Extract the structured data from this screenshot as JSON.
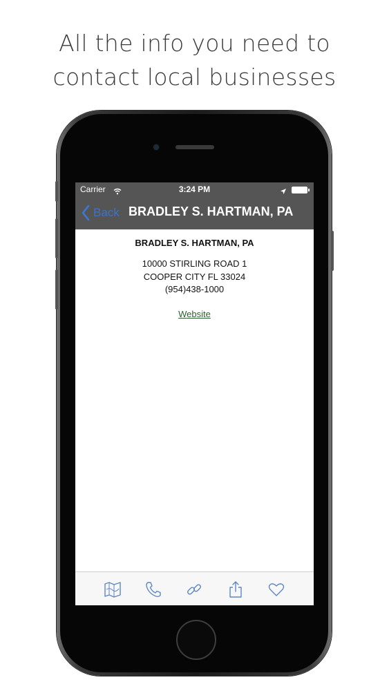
{
  "headline": {
    "line1": "All the info you need to",
    "line2": "contact local businesses"
  },
  "status_bar": {
    "carrier": "Carrier",
    "time": "3:24 PM"
  },
  "nav": {
    "back_label": "Back",
    "title": "BRADLEY S. HARTMAN, PA"
  },
  "business": {
    "name": "BRADLEY S. HARTMAN, PA",
    "address_line1": "10000 STIRLING ROAD 1",
    "address_line2": "COOPER CITY FL 33024",
    "phone": "(954)438-1000",
    "website_label": "Website"
  },
  "toolbar": {
    "items": [
      "map-icon",
      "phone-icon",
      "link-icon",
      "share-icon",
      "heart-icon"
    ]
  },
  "colors": {
    "nav_background": "#555555",
    "accent_blue": "#3b78d8",
    "toolbar_icon": "#5b86c4"
  }
}
